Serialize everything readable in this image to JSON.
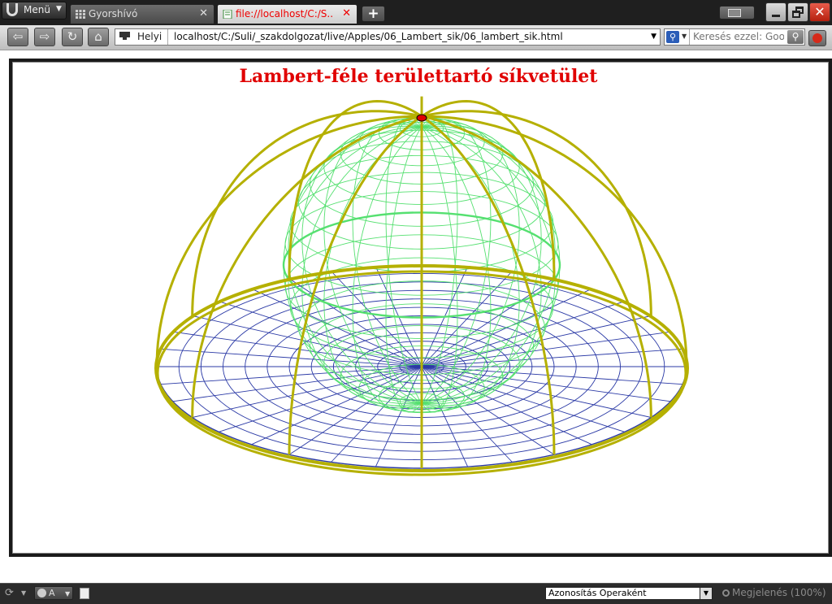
{
  "browser": {
    "menu_label": "Menü",
    "tabs": [
      {
        "label": "Gyorshívó",
        "active": false
      },
      {
        "label": "file://localhost/C:/S...",
        "active": true
      }
    ],
    "close_glyph": "✕",
    "newtab_glyph": "+"
  },
  "navigation": {
    "location_label": "Helyi",
    "url": "localhost/C:/Suli/_szakdolgozat/live/Apples/06_Lambert_sik/06_lambert_sik.html",
    "search_placeholder": "Keresés ezzel: Goo"
  },
  "applet": {
    "title": "Lambert-féle területtartó síkvetület",
    "colors": {
      "title": "#e00000",
      "sphere": "#55e070",
      "plane": "#2b3aa6",
      "meridians": "#b5b000",
      "pole": "#e00000"
    }
  },
  "statusbar": {
    "image_mode": "A",
    "identification": "Azonosítás Operaként",
    "zoom_label": "Megjelenés (100%)"
  }
}
